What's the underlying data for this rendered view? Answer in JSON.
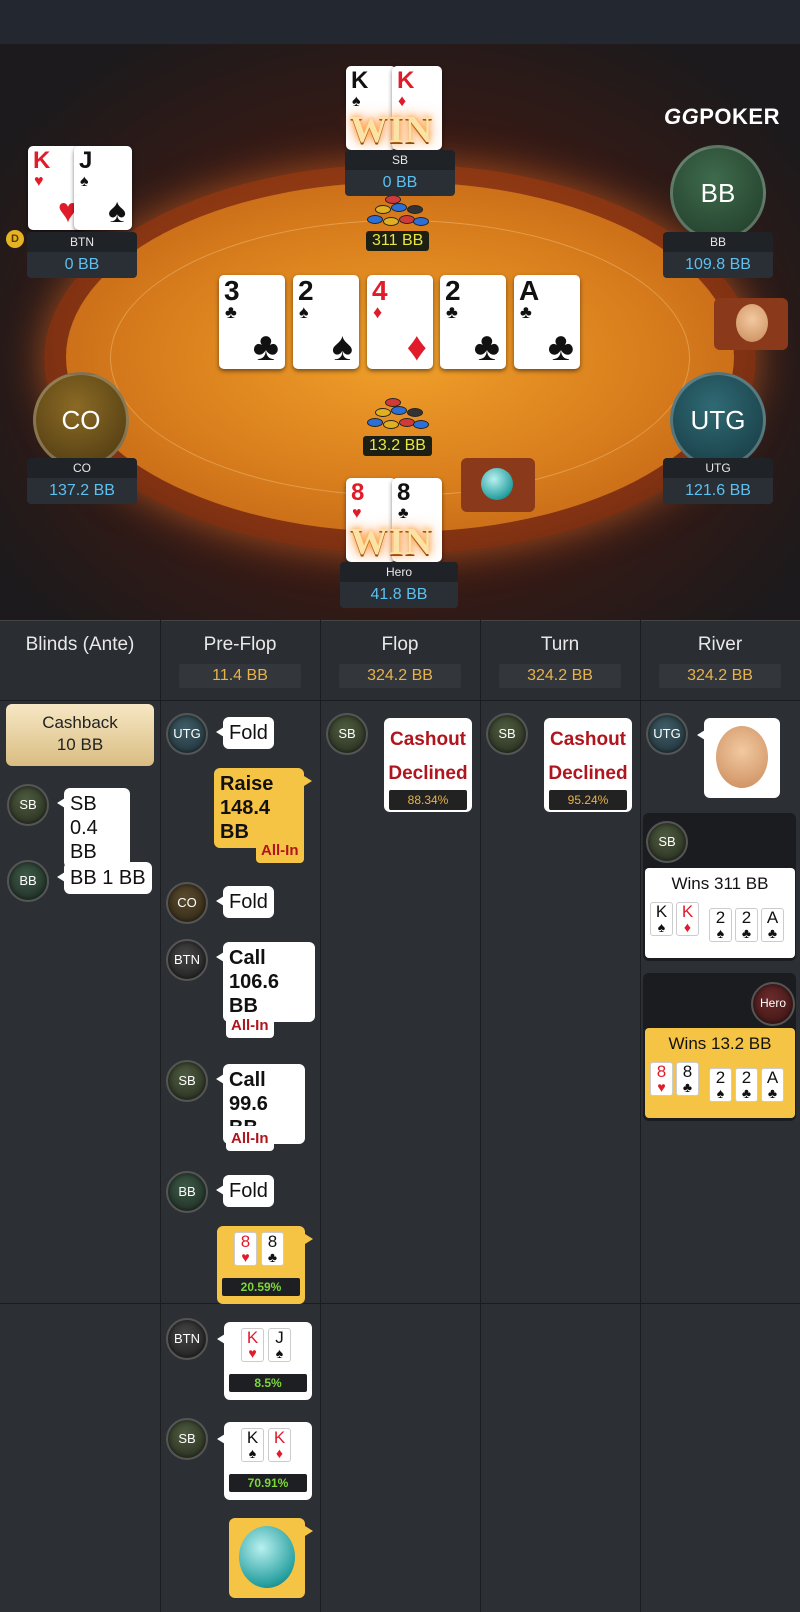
{
  "brand": {
    "logo_gg": "GG",
    "logo_poker": "POKER"
  },
  "table": {
    "board": [
      {
        "rank": "3",
        "suit": "♣",
        "color": "black"
      },
      {
        "rank": "2",
        "suit": "♠",
        "color": "black"
      },
      {
        "rank": "4",
        "suit": "♦",
        "color": "red"
      },
      {
        "rank": "2",
        "suit": "♣",
        "color": "black"
      },
      {
        "rank": "A",
        "suit": "♣",
        "color": "black"
      }
    ],
    "pots": [
      {
        "label": "311 BB"
      },
      {
        "label": "13.2 BB"
      }
    ],
    "win_text": "WIN",
    "dealer_button": "D",
    "seats": {
      "sb": {
        "name": "SB",
        "stack": "0 BB",
        "cards": [
          {
            "rank": "K",
            "suit": "♠"
          },
          {
            "rank": "K",
            "suit": "♦"
          }
        ]
      },
      "btn": {
        "name": "BTN",
        "stack": "0 BB",
        "cards": [
          {
            "rank": "K",
            "suit": "♥"
          },
          {
            "rank": "J",
            "suit": "♠"
          }
        ]
      },
      "bb": {
        "name": "BB",
        "avatar": "BB",
        "stack": "109.8 BB"
      },
      "co": {
        "name": "CO",
        "avatar": "CO",
        "stack": "137.2 BB"
      },
      "utg": {
        "name": "UTG",
        "avatar": "UTG",
        "stack": "121.6 BB"
      },
      "hero": {
        "name": "Hero",
        "stack": "41.8 BB",
        "cards": [
          {
            "rank": "8",
            "suit": "♥"
          },
          {
            "rank": "8",
            "suit": "♣"
          }
        ]
      }
    }
  },
  "history": {
    "columns": [
      {
        "title": "Blinds (Ante)",
        "pot": ""
      },
      {
        "title": "Pre-Flop",
        "pot": "11.4 BB"
      },
      {
        "title": "Flop",
        "pot": "324.2 BB"
      },
      {
        "title": "Turn",
        "pot": "324.2 BB"
      },
      {
        "title": "River",
        "pot": "324.2 BB"
      }
    ],
    "blinds": {
      "cashback_line1": "Cashback",
      "cashback_line2": "10 BB",
      "sb_pos": "SB",
      "sb_line1": "SB",
      "sb_line2": "0.4 BB",
      "bb_pos": "BB",
      "bb_text": "BB 1 BB"
    },
    "preflop": {
      "utg_pos": "UTG",
      "utg_action": "Fold",
      "raise_line1": "Raise",
      "raise_line2": "148.4 BB",
      "raise_allin": "All-In",
      "co_pos": "CO",
      "co_action": "Fold",
      "btn_pos": "BTN",
      "btn_line1": "Call",
      "btn_line2": "106.6 BB",
      "btn_allin": "All-In",
      "sb_pos": "SB",
      "sb_line1": "Call",
      "sb_line2": "99.6 BB",
      "sb_allin": "All-In",
      "bb_pos": "BB",
      "bb_action": "Fold",
      "hero_cards": [
        {
          "rank": "8",
          "suit": "♥"
        },
        {
          "rank": "8",
          "suit": "♣"
        }
      ],
      "hero_equity": "20.59%",
      "btn2_pos": "BTN",
      "btn_cards": [
        {
          "rank": "K",
          "suit": "♥"
        },
        {
          "rank": "J",
          "suit": "♠"
        }
      ],
      "btn_equity": "8.5%",
      "sb2_pos": "SB",
      "sb_cards": [
        {
          "rank": "K",
          "suit": "♠"
        },
        {
          "rank": "K",
          "suit": "♦"
        }
      ],
      "sb_equity": "70.91%"
    },
    "flop": {
      "pos": "SB",
      "line1": "Cashout",
      "line2": "Declined",
      "pct": "88.34%"
    },
    "turn": {
      "pos": "SB",
      "line1": "Cashout",
      "line2": "Declined",
      "pct": "95.24%"
    },
    "river": {
      "utg_pos": "UTG",
      "sb_pos": "SB",
      "sb_win": "Wins 311 BB",
      "sb_cards": [
        {
          "rank": "K",
          "suit": "♠"
        },
        {
          "rank": "K",
          "suit": "♦"
        },
        {
          "rank": "2",
          "suit": "♠"
        },
        {
          "rank": "2",
          "suit": "♣"
        },
        {
          "rank": "A",
          "suit": "♣"
        }
      ],
      "hero_pos": "Hero",
      "hero_win": "Wins 13.2 BB",
      "hero_cards": [
        {
          "rank": "8",
          "suit": "♥"
        },
        {
          "rank": "8",
          "suit": "♣"
        },
        {
          "rank": "2",
          "suit": "♠"
        },
        {
          "rank": "2",
          "suit": "♣"
        },
        {
          "rank": "A",
          "suit": "♣"
        }
      ]
    }
  },
  "colors": {
    "accent_yellow": "#f6c445",
    "stack_blue": "#5cc0f0",
    "pot_yellow": "#e7e53f",
    "decline_red": "#b0151d",
    "equity_green": "#7ed63b"
  }
}
